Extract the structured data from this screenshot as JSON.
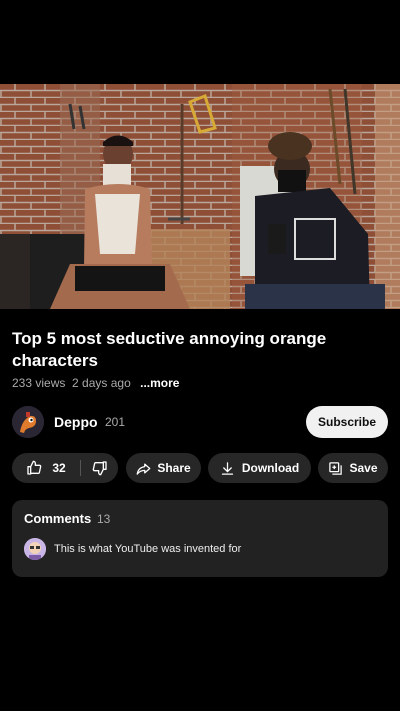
{
  "video": {
    "title": "Top 5 most seductive annoying orange characters",
    "views": "233 views",
    "age": "2 days ago",
    "more_label": "...more"
  },
  "channel": {
    "name": "Deppo",
    "subscribers": "201",
    "subscribe_label": "Subscribe"
  },
  "actions": {
    "like_count": "32",
    "share_label": "Share",
    "download_label": "Download",
    "save_label": "Save"
  },
  "comments": {
    "heading": "Comments",
    "count": "13",
    "top_comment": "This is what YouTube was invented for"
  },
  "colors": {
    "background": "#000000",
    "pill": "#272727",
    "subscribe_bg": "#f1f1f1",
    "comments_bg": "#222222"
  },
  "icons": [
    "like-icon",
    "dislike-icon",
    "share-icon",
    "download-icon",
    "save-icon"
  ]
}
